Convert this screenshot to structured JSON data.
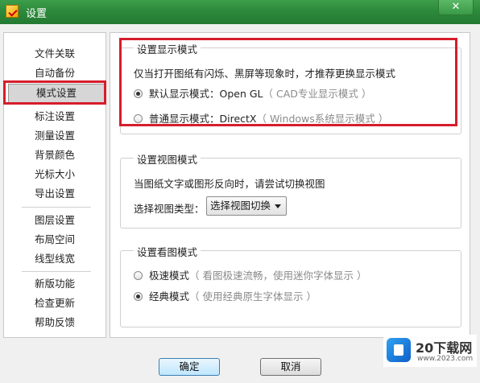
{
  "window": {
    "title": "设置",
    "close_label": "✕"
  },
  "sidebar": {
    "items": [
      {
        "label": "文件关联"
      },
      {
        "label": "自动备份"
      },
      {
        "label": "模式设置"
      },
      {
        "label": "标注设置"
      },
      {
        "label": "测量设置"
      },
      {
        "label": "背景颜色"
      },
      {
        "label": "光标大小"
      },
      {
        "label": "导出设置"
      },
      {
        "label": "图层设置"
      },
      {
        "label": "布局空间"
      },
      {
        "label": "线型线宽"
      },
      {
        "label": "新版功能"
      },
      {
        "label": "检查更新"
      },
      {
        "label": "帮助反馈"
      }
    ],
    "selected": "模式设置"
  },
  "display_mode": {
    "title": "设置显示模式",
    "description": "仅当打开图纸有闪烁、黑屏等现象时，才推荐更换显示模式",
    "options": [
      {
        "label": "默认显示模式：Open GL",
        "hint": "（ CAD专业显示模式 ）",
        "checked": true
      },
      {
        "label": "普通显示模式：DirectX",
        "hint": "（ Windows系统显示模式 ）",
        "checked": false
      }
    ]
  },
  "view_mode": {
    "title": "设置视图模式",
    "description": "当图纸文字或图形反向时，请尝试切换视图",
    "select_label": "选择视图类型：",
    "select_value": "选择视图切换"
  },
  "look_mode": {
    "title": "设置看图模式",
    "options": [
      {
        "label": "极速模式",
        "hint": "（ 看图极速流畅，使用迷你字体显示 ）",
        "checked": false
      },
      {
        "label": "经典模式",
        "hint": "（ 使用经典原生字体显示 ）",
        "checked": true
      }
    ]
  },
  "footer": {
    "ok_label": "确定",
    "cancel_label": "取消"
  },
  "watermark": {
    "brand": "20下载网",
    "url": "www.2023.com"
  },
  "colors": {
    "title_bar": "#2d8a3c",
    "highlight": "#d61d2c"
  }
}
